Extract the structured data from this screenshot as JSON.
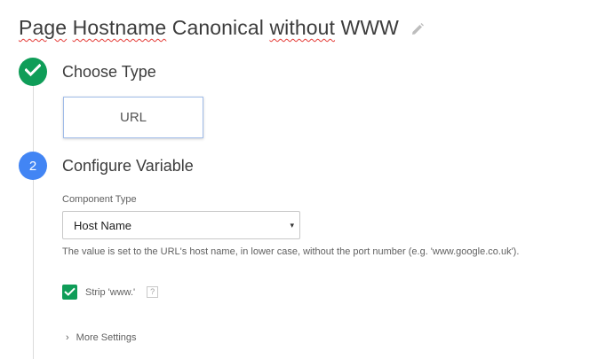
{
  "header": {
    "title_parts": [
      "Page",
      "Hostname",
      "Canonical",
      "without",
      "WWW"
    ],
    "edit_icon": "pencil-icon"
  },
  "step1": {
    "label": "Choose Type",
    "icon": "check-icon",
    "selected_type": "URL",
    "color": "#0f9d58"
  },
  "step2": {
    "number": "2",
    "label": "Configure Variable",
    "color": "#4285f4",
    "component_type_label": "Component Type",
    "component_type_value": "Host Name",
    "dropdown_arrow": "▾",
    "helper_text": "The value is set to the URL's host name, in lower case, without the port number (e.g. 'www.google.co.uk').",
    "strip_www_label": "Strip 'www.'",
    "strip_www_checked": true,
    "help_label": "?",
    "more_settings_label": "More Settings",
    "more_settings_chevron": "›"
  }
}
